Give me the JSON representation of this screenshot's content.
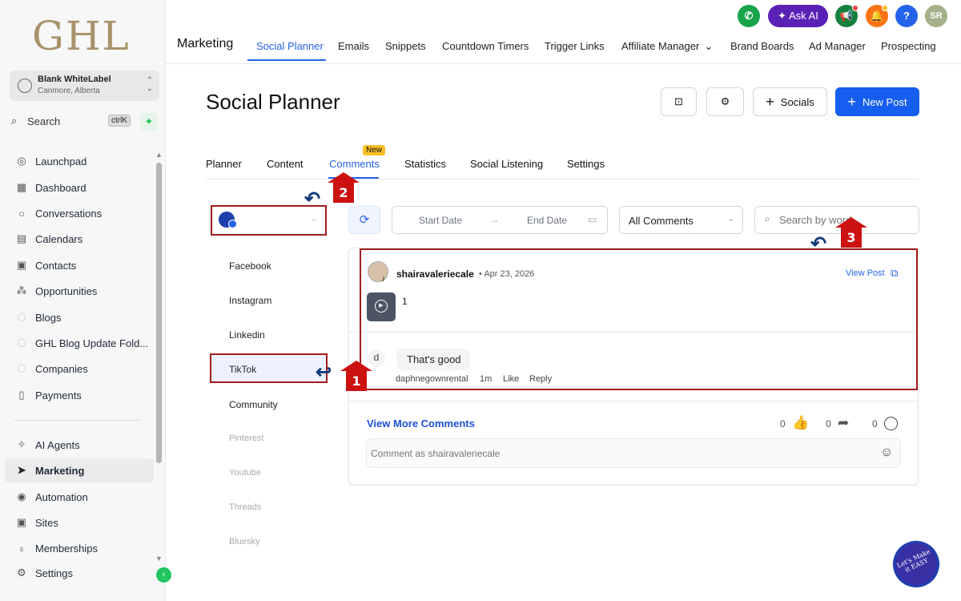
{
  "sidebar": {
    "logo": "GHL",
    "account": {
      "name": "Blank WhiteLabel",
      "location": "Canmore, Alberta"
    },
    "search": {
      "label": "Search",
      "shortcut": "ctrlK"
    },
    "items": [
      {
        "label": "Launchpad",
        "icon": "rocket-icon"
      },
      {
        "label": "Dashboard",
        "icon": "grid-icon"
      },
      {
        "label": "Conversations",
        "icon": "chat-icon"
      },
      {
        "label": "Calendars",
        "icon": "calendar-icon"
      },
      {
        "label": "Contacts",
        "icon": "contacts-icon"
      },
      {
        "label": "Opportunities",
        "icon": "opportunities-icon"
      },
      {
        "label": "Blogs",
        "icon": "cube-icon"
      },
      {
        "label": "GHL Blog Update Fold...",
        "icon": "cube-icon"
      },
      {
        "label": "Companies",
        "icon": "cube-icon"
      },
      {
        "label": "Payments",
        "icon": "payments-icon"
      },
      {
        "label": "AI Agents",
        "icon": "sparkle-icon"
      },
      {
        "label": "Marketing",
        "icon": "send-icon"
      },
      {
        "label": "Automation",
        "icon": "automation-icon"
      },
      {
        "label": "Sites",
        "icon": "sites-icon"
      },
      {
        "label": "Memberships",
        "icon": "medal-icon"
      },
      {
        "label": "Settings",
        "icon": "gear-icon"
      }
    ]
  },
  "header": {
    "section": "Marketing",
    "ask_ai": "Ask AI",
    "user_initials": "SR",
    "tabs": [
      "Social Planner",
      "Emails",
      "Snippets",
      "Countdown Timers",
      "Trigger Links",
      "Affiliate Manager",
      "Brand Boards",
      "Ad Manager",
      "Prospecting"
    ]
  },
  "page": {
    "title": "Social Planner",
    "socials_button": "Socials",
    "new_post_button": "New Post",
    "tabs": [
      "Planner",
      "Content",
      "Comments",
      "Statistics",
      "Social Listening",
      "Settings"
    ],
    "new_badge": "New"
  },
  "platforms": [
    "Facebook",
    "Instagram",
    "Linkedin",
    "TikTok",
    "Community",
    "Pinterest",
    "Youtube",
    "Threads",
    "Bluesky"
  ],
  "filters": {
    "start_date": "Start Date",
    "end_date": "End Date",
    "comment_filter": "All Comments",
    "search_placeholder": "Search by word"
  },
  "post": {
    "username": "shairavaleriecale",
    "date": "Apr 23, 2026",
    "view_post": "View Post",
    "text": "1",
    "comment": {
      "avatar_letter": "d",
      "text": "That's good",
      "author": "daphnegownrental",
      "time": "1m",
      "like": "Like",
      "reply": "Reply"
    },
    "view_more": "View More Comments",
    "likes": "0",
    "shares": "0",
    "comments": "0",
    "comment_placeholder": "Comment as shairavaleriecale"
  },
  "annotations": [
    "1",
    "2",
    "3"
  ],
  "badge": "Let's Make it EASY",
  "colors": {
    "accent": "#155eef",
    "annotation": "#cc1111",
    "logo": "#a8926a"
  }
}
